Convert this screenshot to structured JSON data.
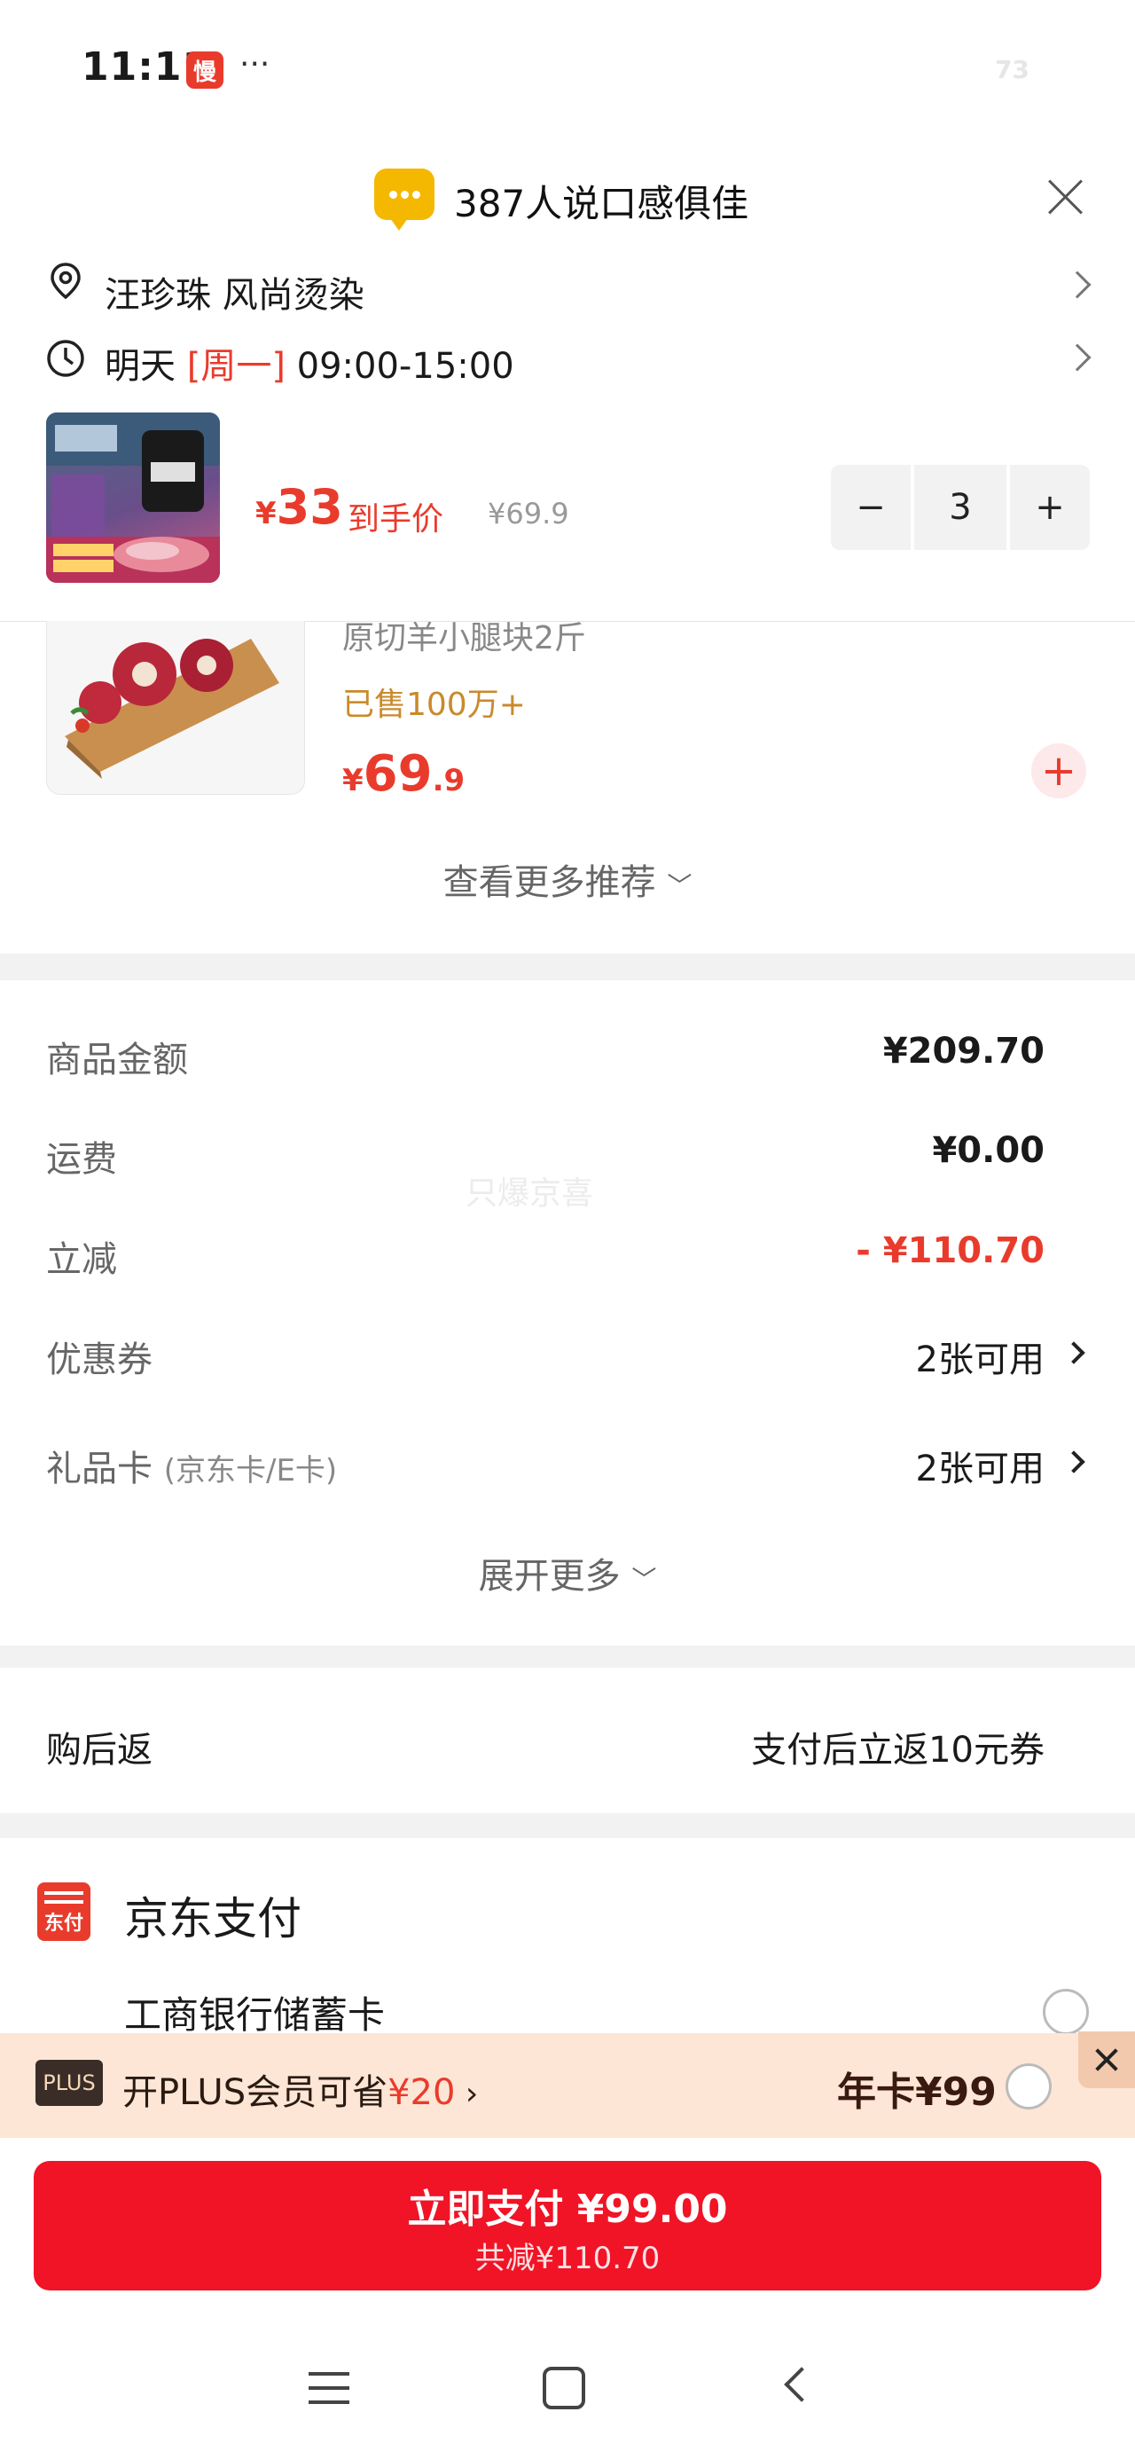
{
  "status_bar": {
    "time": "11:11",
    "app_badge": "慢",
    "more": "···",
    "battery": "73"
  },
  "review_banner": {
    "text": "387人说口感俱佳"
  },
  "address": {
    "text": "汪珍珠  风尚烫染"
  },
  "delivery_time": {
    "day": "明天",
    "week": "[周一]",
    "slot": "09:00-15:00"
  },
  "product": {
    "price_symbol": "¥",
    "price": "33",
    "price_tag": "到手价",
    "original_price": "¥69.9",
    "quantity": "3",
    "minus": "−",
    "plus": "+"
  },
  "recommendation": {
    "name": "原切羊小腿块2斤",
    "sold": "已售100万+",
    "price_symbol": "¥",
    "price_int": "69",
    "price_dec": ".9",
    "add": "+",
    "more_label": "查看更多推荐"
  },
  "amounts": {
    "goods_label": "商品金额",
    "goods_value": "¥209.70",
    "shipping_label": "运费",
    "shipping_value": "¥0.00",
    "discount_label": "立减",
    "discount_value": "- ¥110.70",
    "coupon_label": "优惠券",
    "coupon_value": "2张可用",
    "giftcard_label": "礼品卡",
    "giftcard_note": "(京东卡/E卡)",
    "giftcard_value": "2张可用",
    "watermark": "只爆京喜",
    "expand_label": "展开更多"
  },
  "after_purchase": {
    "label": "购后返",
    "value": "支付后立返10元券"
  },
  "payment": {
    "icon_text": "东付",
    "title": "京东支付",
    "bank": "工商银行储蓄卡"
  },
  "plus_bar": {
    "badge": "PLUS",
    "text_prefix": "开PLUS会员可省",
    "save_amount": "¥20",
    "year_card": "年卡¥99"
  },
  "pay_button": {
    "label": "立即支付 ¥99.00",
    "sub": "共减¥110.70"
  },
  "colors": {
    "accent": "#e93b2c",
    "pay_button": "#f01426",
    "plus_bar_bg": "#fde6d6"
  }
}
